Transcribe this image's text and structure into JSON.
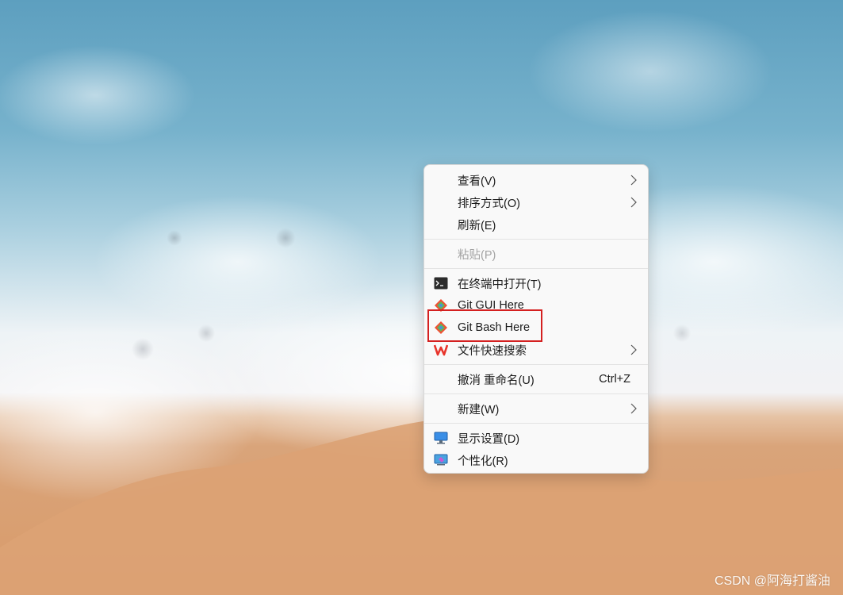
{
  "menu": {
    "items": [
      {
        "label": "查看(V)"
      },
      {
        "label": "排序方式(O)"
      },
      {
        "label": "刷新(E)"
      },
      {
        "label": "粘贴(P)"
      },
      {
        "label": "在终端中打开(T)"
      },
      {
        "label": "Git GUI Here"
      },
      {
        "label": "Git Bash Here"
      },
      {
        "label": "文件快速搜索"
      },
      {
        "label": "撤消 重命名(U)",
        "shortcut": "Ctrl+Z"
      },
      {
        "label": "新建(W)"
      },
      {
        "label": "显示设置(D)"
      },
      {
        "label": "个性化(R)"
      }
    ]
  },
  "watermark": "CSDN @阿海打酱油",
  "colors": {
    "highlight_box": "#d42020",
    "menu_background": "#f9f9f9",
    "disabled_text": "#a3a3a3"
  },
  "icons": {
    "terminal": "terminal-icon",
    "git_gui": "git-icon",
    "git_bash": "git-icon",
    "file_search": "wps-search-icon",
    "display_settings": "monitor-icon",
    "personalize": "personalize-icon"
  }
}
